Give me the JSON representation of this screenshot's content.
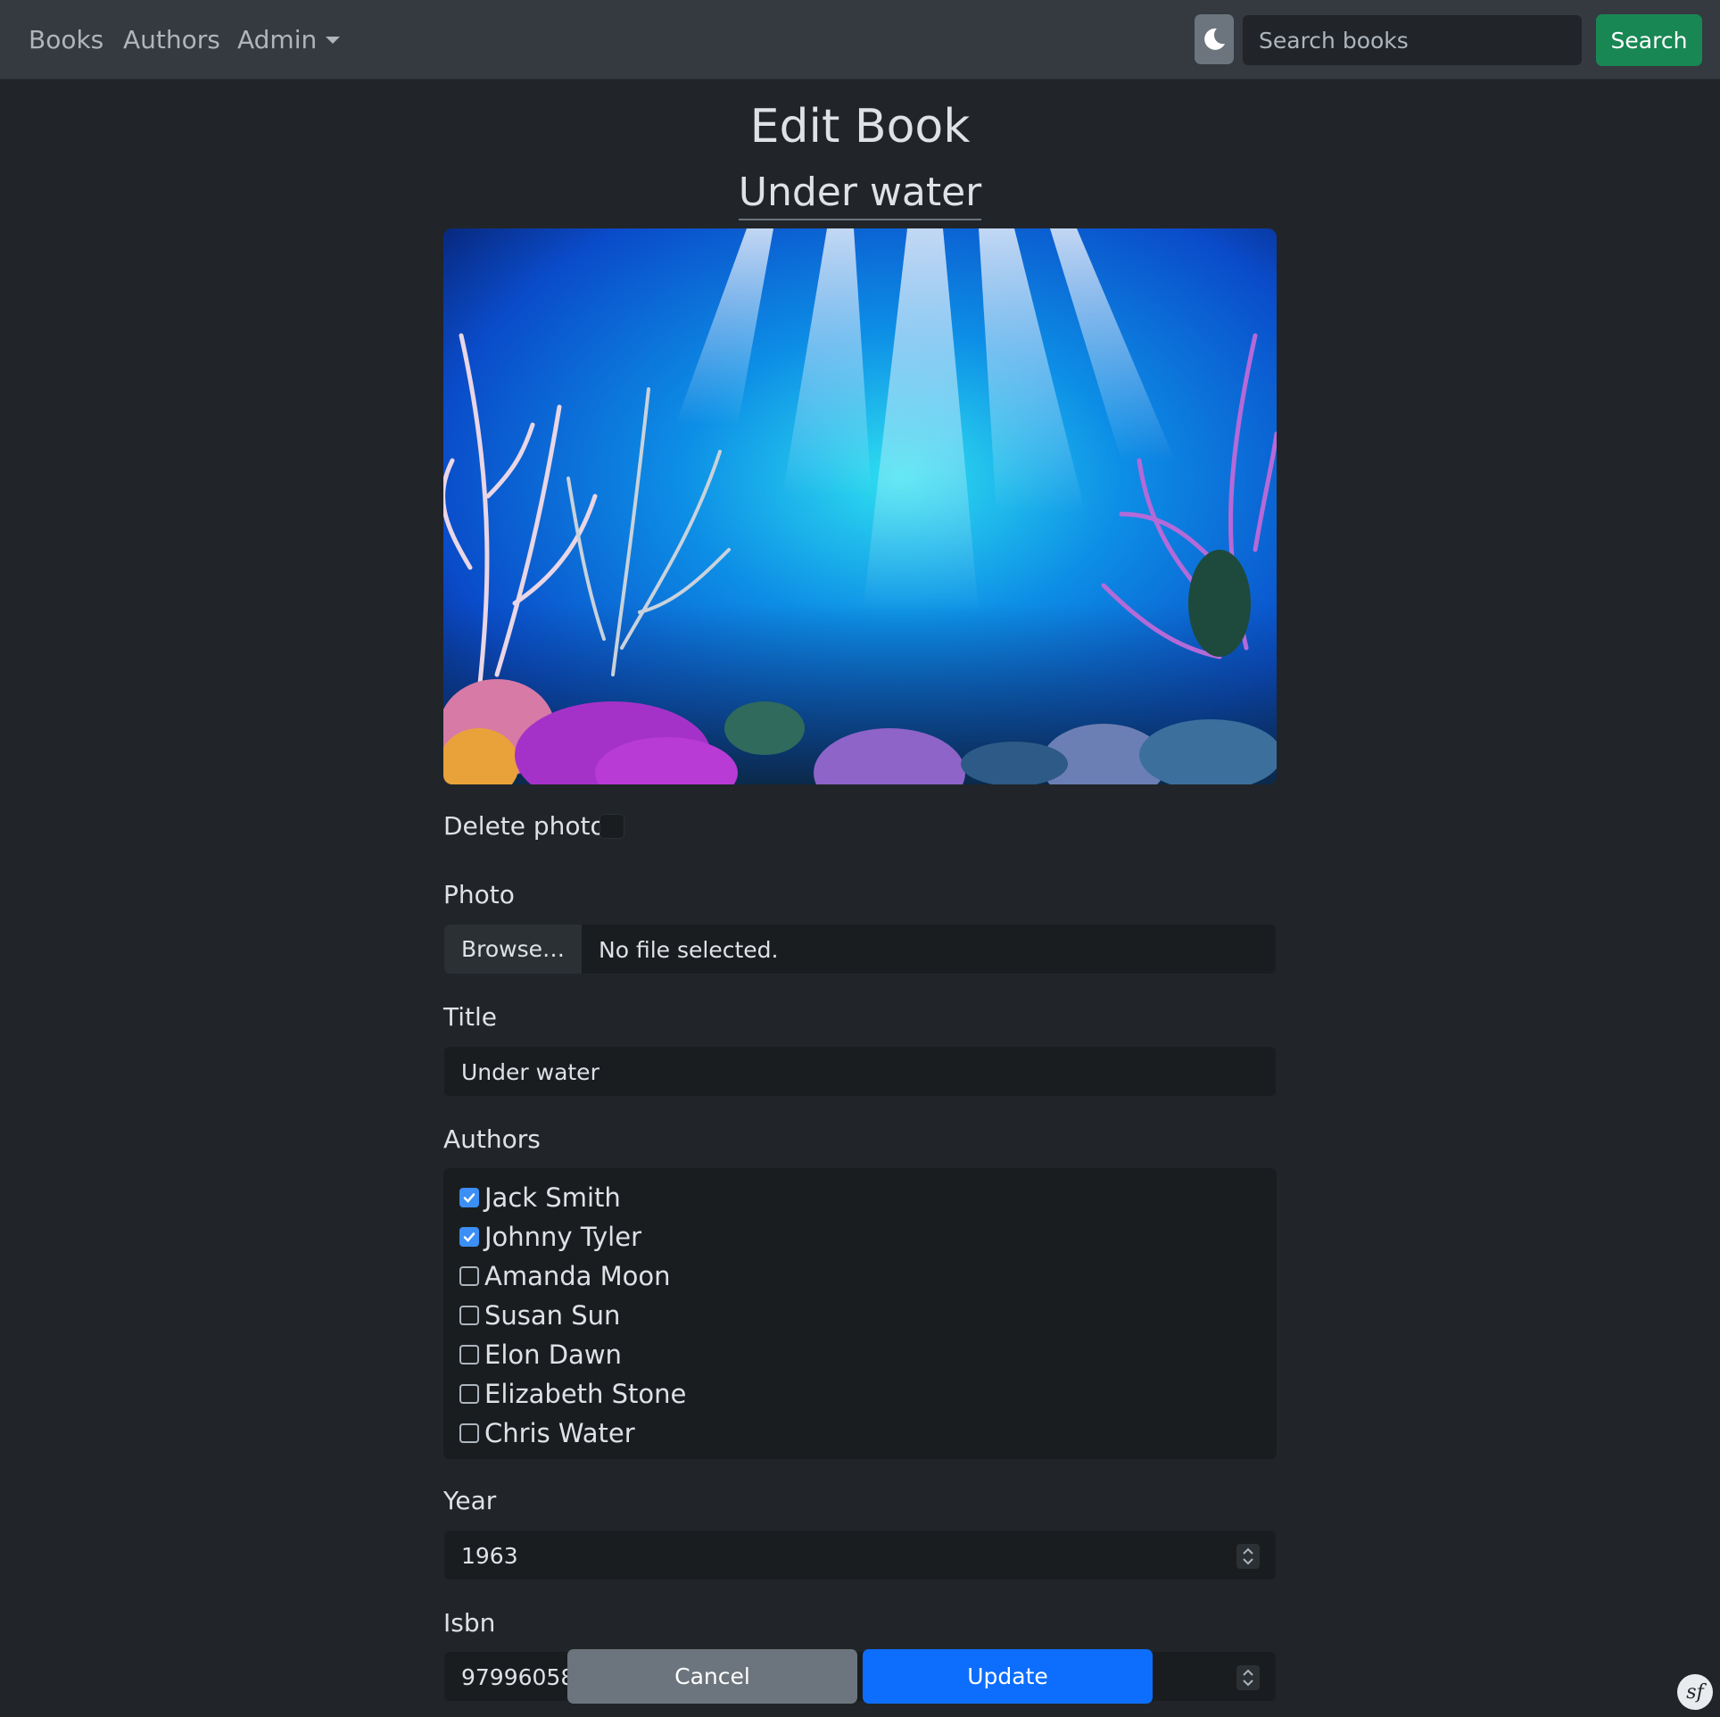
{
  "nav": {
    "items": [
      {
        "label": "Books"
      },
      {
        "label": "Authors"
      },
      {
        "label": "Admin"
      }
    ],
    "theme_icon": "moon-icon",
    "search": {
      "placeholder": "Search books",
      "button_label": "Search"
    }
  },
  "page": {
    "title": "Edit Book",
    "book_name": "Under water"
  },
  "colors": {
    "background": "#212529",
    "navbar": "#343a40",
    "search_button": "#198754",
    "update_button": "#0d6efd",
    "cancel_button": "#6c757d",
    "checkbox_checked": "#3b8ff5"
  },
  "form": {
    "delete_photo_label": "Delete photo",
    "delete_photo_checked": false,
    "photo": {
      "label": "Photo",
      "browse_label": "Browse…",
      "status": "No file selected."
    },
    "title": {
      "label": "Title",
      "value": "Under water"
    },
    "authors": {
      "label": "Authors",
      "options": [
        {
          "name": "Jack Smith",
          "checked": true
        },
        {
          "name": "Johnny Tyler",
          "checked": true
        },
        {
          "name": "Amanda Moon",
          "checked": false
        },
        {
          "name": "Susan Sun",
          "checked": false
        },
        {
          "name": "Elon Dawn",
          "checked": false
        },
        {
          "name": "Elizabeth Stone",
          "checked": false
        },
        {
          "name": "Chris Water",
          "checked": false
        }
      ]
    },
    "year": {
      "label": "Year",
      "value": "1963"
    },
    "isbn": {
      "label": "Isbn",
      "value": "97996058"
    },
    "cancel_label": "Cancel",
    "update_label": "Update"
  },
  "debug_badge": "sf"
}
